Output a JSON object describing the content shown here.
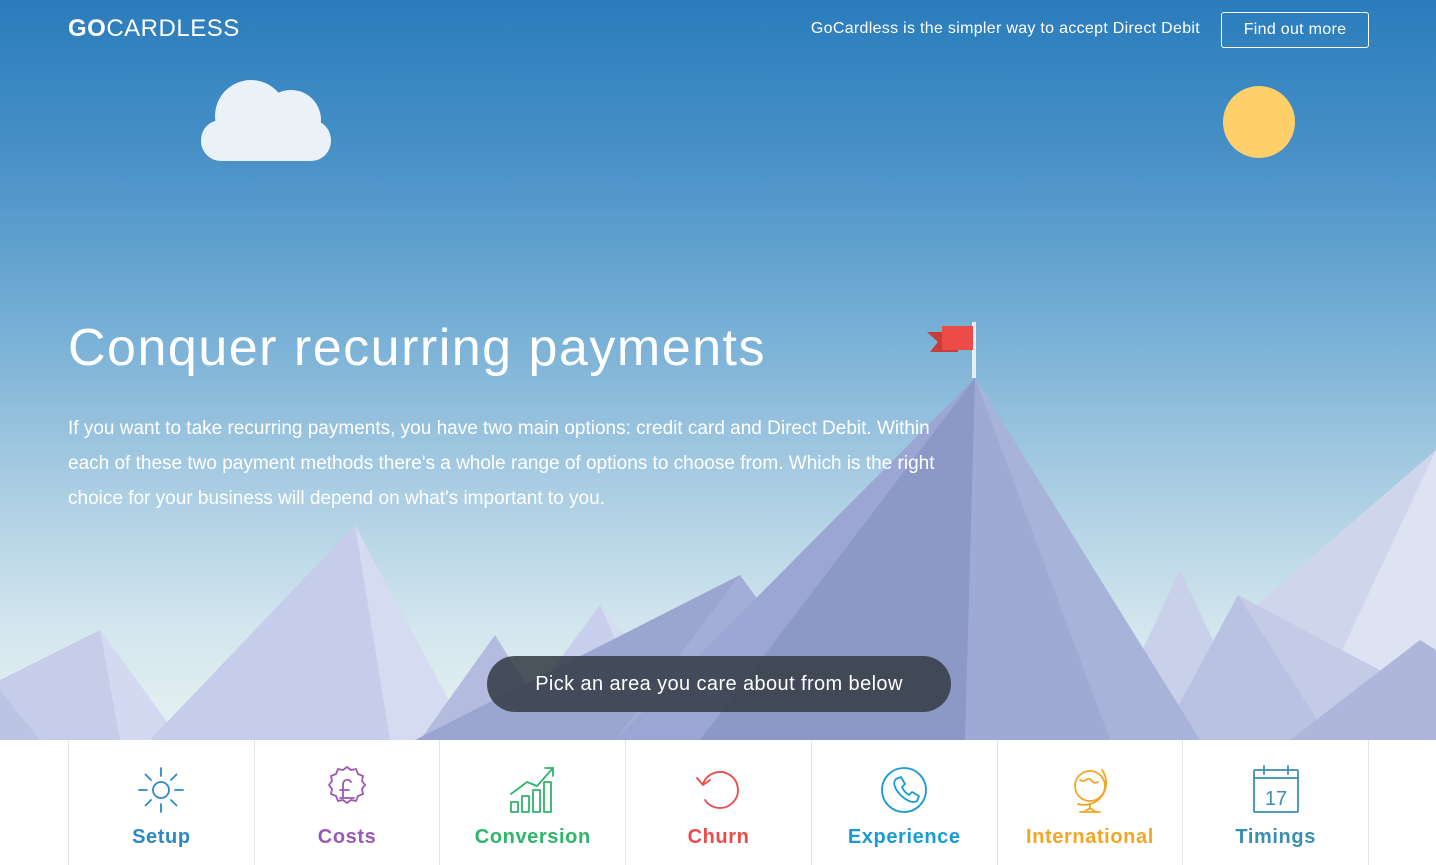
{
  "header": {
    "logo_bold": "GO",
    "logo_light": "CARDLESS",
    "tagline": "GoCardless is the simpler way to accept Direct Debit",
    "cta_label": "Find out more"
  },
  "hero": {
    "headline": "Conquer recurring payments",
    "intro": "If you want to take recurring payments, you have two main options: credit card and Direct Debit. Within each of these two payment methods there's a whole range of options to choose from. Which is the right choice for your business will depend on what's important to you.",
    "pick_prompt": "Pick an area you care about from below"
  },
  "categories": [
    {
      "label": "Setup",
      "icon": "sun-icon",
      "color": "#2b8ac6"
    },
    {
      "label": "Costs",
      "icon": "pound-coin-icon",
      "color": "#9b59b6"
    },
    {
      "label": "Conversion",
      "icon": "bar-chart-growth-icon",
      "color": "#2fb56a"
    },
    {
      "label": "Churn",
      "icon": "refresh-arrow-icon",
      "color": "#ec4b4b"
    },
    {
      "label": "Experience",
      "icon": "phone-icon",
      "color": "#1a9ad6"
    },
    {
      "label": "International",
      "icon": "globe-icon",
      "color": "#f3a626"
    },
    {
      "label": "Timings",
      "icon": "calendar-icon",
      "color": "#3a8fb0",
      "calendar_day": "17"
    }
  ],
  "colors": {
    "sky_top": "#2a7cbc",
    "sun": "#ffcf6a",
    "cloud": "#eaf1f7",
    "flag": "#e94a47",
    "pill": "#373e48"
  }
}
